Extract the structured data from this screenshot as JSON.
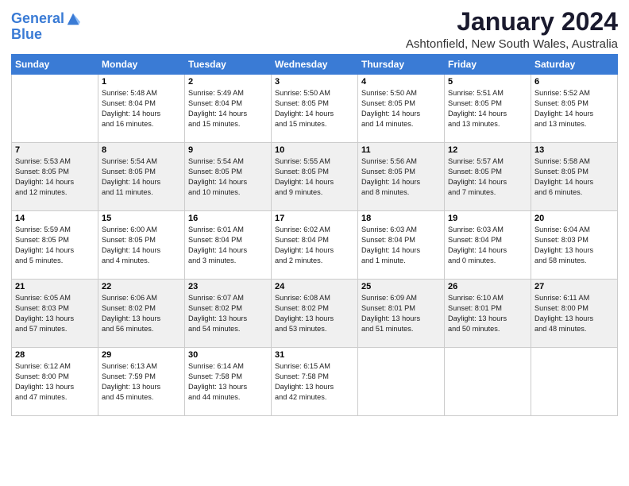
{
  "logo": {
    "line1": "General",
    "line2": "Blue"
  },
  "title": "January 2024",
  "location": "Ashtonfield, New South Wales, Australia",
  "days_header": [
    "Sunday",
    "Monday",
    "Tuesday",
    "Wednesday",
    "Thursday",
    "Friday",
    "Saturday"
  ],
  "weeks": [
    [
      {
        "num": "",
        "info": ""
      },
      {
        "num": "1",
        "info": "Sunrise: 5:48 AM\nSunset: 8:04 PM\nDaylight: 14 hours\nand 16 minutes."
      },
      {
        "num": "2",
        "info": "Sunrise: 5:49 AM\nSunset: 8:04 PM\nDaylight: 14 hours\nand 15 minutes."
      },
      {
        "num": "3",
        "info": "Sunrise: 5:50 AM\nSunset: 8:05 PM\nDaylight: 14 hours\nand 15 minutes."
      },
      {
        "num": "4",
        "info": "Sunrise: 5:50 AM\nSunset: 8:05 PM\nDaylight: 14 hours\nand 14 minutes."
      },
      {
        "num": "5",
        "info": "Sunrise: 5:51 AM\nSunset: 8:05 PM\nDaylight: 14 hours\nand 13 minutes."
      },
      {
        "num": "6",
        "info": "Sunrise: 5:52 AM\nSunset: 8:05 PM\nDaylight: 14 hours\nand 13 minutes."
      }
    ],
    [
      {
        "num": "7",
        "info": "Sunrise: 5:53 AM\nSunset: 8:05 PM\nDaylight: 14 hours\nand 12 minutes."
      },
      {
        "num": "8",
        "info": "Sunrise: 5:54 AM\nSunset: 8:05 PM\nDaylight: 14 hours\nand 11 minutes."
      },
      {
        "num": "9",
        "info": "Sunrise: 5:54 AM\nSunset: 8:05 PM\nDaylight: 14 hours\nand 10 minutes."
      },
      {
        "num": "10",
        "info": "Sunrise: 5:55 AM\nSunset: 8:05 PM\nDaylight: 14 hours\nand 9 minutes."
      },
      {
        "num": "11",
        "info": "Sunrise: 5:56 AM\nSunset: 8:05 PM\nDaylight: 14 hours\nand 8 minutes."
      },
      {
        "num": "12",
        "info": "Sunrise: 5:57 AM\nSunset: 8:05 PM\nDaylight: 14 hours\nand 7 minutes."
      },
      {
        "num": "13",
        "info": "Sunrise: 5:58 AM\nSunset: 8:05 PM\nDaylight: 14 hours\nand 6 minutes."
      }
    ],
    [
      {
        "num": "14",
        "info": "Sunrise: 5:59 AM\nSunset: 8:05 PM\nDaylight: 14 hours\nand 5 minutes."
      },
      {
        "num": "15",
        "info": "Sunrise: 6:00 AM\nSunset: 8:05 PM\nDaylight: 14 hours\nand 4 minutes."
      },
      {
        "num": "16",
        "info": "Sunrise: 6:01 AM\nSunset: 8:04 PM\nDaylight: 14 hours\nand 3 minutes."
      },
      {
        "num": "17",
        "info": "Sunrise: 6:02 AM\nSunset: 8:04 PM\nDaylight: 14 hours\nand 2 minutes."
      },
      {
        "num": "18",
        "info": "Sunrise: 6:03 AM\nSunset: 8:04 PM\nDaylight: 14 hours\nand 1 minute."
      },
      {
        "num": "19",
        "info": "Sunrise: 6:03 AM\nSunset: 8:04 PM\nDaylight: 14 hours\nand 0 minutes."
      },
      {
        "num": "20",
        "info": "Sunrise: 6:04 AM\nSunset: 8:03 PM\nDaylight: 13 hours\nand 58 minutes."
      }
    ],
    [
      {
        "num": "21",
        "info": "Sunrise: 6:05 AM\nSunset: 8:03 PM\nDaylight: 13 hours\nand 57 minutes."
      },
      {
        "num": "22",
        "info": "Sunrise: 6:06 AM\nSunset: 8:02 PM\nDaylight: 13 hours\nand 56 minutes."
      },
      {
        "num": "23",
        "info": "Sunrise: 6:07 AM\nSunset: 8:02 PM\nDaylight: 13 hours\nand 54 minutes."
      },
      {
        "num": "24",
        "info": "Sunrise: 6:08 AM\nSunset: 8:02 PM\nDaylight: 13 hours\nand 53 minutes."
      },
      {
        "num": "25",
        "info": "Sunrise: 6:09 AM\nSunset: 8:01 PM\nDaylight: 13 hours\nand 51 minutes."
      },
      {
        "num": "26",
        "info": "Sunrise: 6:10 AM\nSunset: 8:01 PM\nDaylight: 13 hours\nand 50 minutes."
      },
      {
        "num": "27",
        "info": "Sunrise: 6:11 AM\nSunset: 8:00 PM\nDaylight: 13 hours\nand 48 minutes."
      }
    ],
    [
      {
        "num": "28",
        "info": "Sunrise: 6:12 AM\nSunset: 8:00 PM\nDaylight: 13 hours\nand 47 minutes."
      },
      {
        "num": "29",
        "info": "Sunrise: 6:13 AM\nSunset: 7:59 PM\nDaylight: 13 hours\nand 45 minutes."
      },
      {
        "num": "30",
        "info": "Sunrise: 6:14 AM\nSunset: 7:58 PM\nDaylight: 13 hours\nand 44 minutes."
      },
      {
        "num": "31",
        "info": "Sunrise: 6:15 AM\nSunset: 7:58 PM\nDaylight: 13 hours\nand 42 minutes."
      },
      {
        "num": "",
        "info": ""
      },
      {
        "num": "",
        "info": ""
      },
      {
        "num": "",
        "info": ""
      }
    ]
  ]
}
